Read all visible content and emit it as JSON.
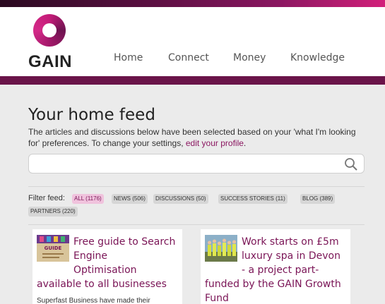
{
  "brand": {
    "logo_text": "GAIN",
    "accent": "#8a1660",
    "dark_purple": "#6a1449",
    "pink": "#c51c79"
  },
  "nav": {
    "items": [
      {
        "label": "Home"
      },
      {
        "label": "Connect"
      },
      {
        "label": "Money"
      },
      {
        "label": "Knowledge"
      }
    ]
  },
  "feed": {
    "title": "Your home feed",
    "intro_text": "The articles and discussions below have been selected based on your 'what I'm looking for' preferences. To change your settings,",
    "intro_link": "edit your profile",
    "intro_end": ".",
    "search": {
      "value": "",
      "placeholder": "",
      "icon": "search-icon"
    },
    "filter_label": "Filter feed:",
    "filters": [
      {
        "label": "ALL (1176)",
        "active": true
      },
      {
        "label": "NEWS (506)",
        "active": false
      },
      {
        "label": "DISCUSSIONS (50)",
        "active": false
      },
      {
        "label": "SUCCESS STORIES (11)",
        "active": false
      },
      {
        "label": "BLOG (389)",
        "active": false
      },
      {
        "label": "PARTNERS (220)",
        "active": false
      }
    ],
    "cards": [
      {
        "title_lines": [
          "Free guide to Search",
          "Engine",
          "Optimisation",
          "available to all businesses"
        ],
        "excerpt": "Superfast Business have made their",
        "thumb_icon": "guide-thumbnail-icon",
        "thumb_text": "GUIDE"
      },
      {
        "title_lines": [
          "Work starts on £5m",
          "luxury spa in Devon",
          "- a project part-",
          "funded by the GAIN Growth",
          "Fund"
        ],
        "excerpt": "",
        "thumb_icon": "construction-photo-icon"
      }
    ]
  }
}
